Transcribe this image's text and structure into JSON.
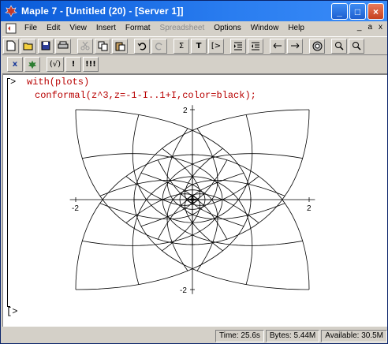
{
  "window": {
    "title": "Maple 7 - [Untitled (20) - [Server 1]]",
    "minimize_label": "_",
    "maximize_label": "□",
    "close_label": "×"
  },
  "menubar": {
    "items": [
      "File",
      "Edit",
      "View",
      "Insert",
      "Format",
      "Spreadsheet",
      "Options",
      "Window",
      "Help"
    ],
    "doc_controls": [
      "_",
      "a",
      "x"
    ]
  },
  "toolbar1": {
    "buttons": [
      "new-doc",
      "open",
      "save",
      "print",
      "cut",
      "copy",
      "paste",
      "undo",
      "redo",
      "sigma",
      "T",
      "exec-group",
      "indent-in",
      "indent-out",
      "back",
      "forward",
      "stop",
      "zoom-in",
      "zoom-out"
    ],
    "sigma_label": "Σ",
    "text_label": "T",
    "exec_label": "[>"
  },
  "toolbar2": {
    "x_label": "x",
    "sqrt_label": "(√)",
    "excl_label": "!",
    "excl3_label": "!!!"
  },
  "worksheet": {
    "prompt": ">",
    "line1": "with(plots)",
    "line2": "conformal(z^3,z=-1-I..1+I,color=black);",
    "empty_prompt": "[>"
  },
  "plot": {
    "x_tick_neg": "-2",
    "x_tick_pos": "2",
    "y_tick_pos": "2",
    "y_tick_neg": "-2"
  },
  "chart_data": {
    "type": "conformal",
    "function": "z^3",
    "domain": "z = -1-I .. 1+I",
    "color": "black",
    "xlim": [
      -2,
      2
    ],
    "ylim": [
      -2,
      2
    ]
  },
  "statusbar": {
    "time": "Time: 25.6s",
    "bytes": "Bytes: 5.44M",
    "available": "Available: 30.5M"
  }
}
